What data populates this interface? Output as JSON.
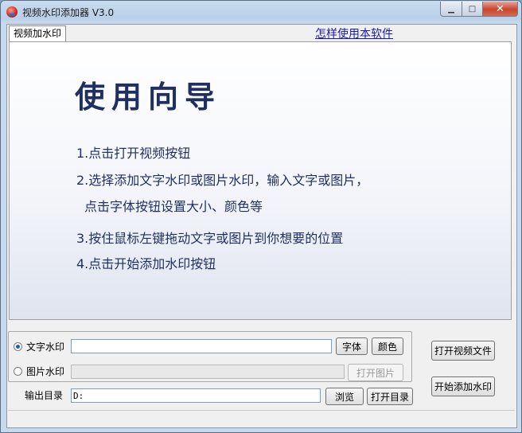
{
  "window": {
    "title": "视频水印添加器 V3.0",
    "caption": {
      "minimize": "▁",
      "maximize": "□",
      "close": "✕"
    }
  },
  "tab": {
    "label": "视频加水印"
  },
  "help_link": "怎样使用本软件",
  "guide": {
    "title": "使用向导",
    "steps": [
      "1.点击打开视频按钮",
      "2.选择添加文字水印或图片水印，输入文字或图片，",
      "点击字体按钮设置大小、颜色等",
      "3.按住鼠标左键拖动文字或图片到你想要的位置",
      "4.点击开始添加水印按钮"
    ]
  },
  "watermark": {
    "text_option": {
      "label": "文字水印",
      "selected": true,
      "value": ""
    },
    "image_option": {
      "label": "图片水印",
      "selected": false,
      "value": ""
    },
    "font_button": "字体",
    "color_button": "颜色",
    "open_image_button": "打开图片"
  },
  "output": {
    "label": "输出目录",
    "value": "D:",
    "browse_button": "浏览",
    "open_dir_button": "打开目录"
  },
  "actions": {
    "open_video": "打开视频文件",
    "start": "开始添加水印"
  },
  "status": ""
}
